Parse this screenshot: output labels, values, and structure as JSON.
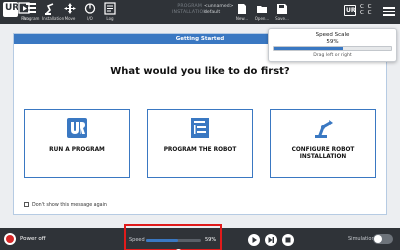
{
  "topbar": {
    "logo_text": "UR",
    "nav": [
      {
        "label": "Run",
        "icon": "run-icon"
      },
      {
        "label": "Program",
        "icon": "program-icon"
      },
      {
        "label": "Installation",
        "icon": "installation-icon"
      },
      {
        "label": "Move",
        "icon": "move-icon"
      },
      {
        "label": "I/O",
        "icon": "io-icon"
      },
      {
        "label": "Log",
        "icon": "log-icon"
      }
    ],
    "program_key": "PROGRAM",
    "program_value": "<unnamed>",
    "installation_key": "INSTALLATION",
    "installation_value": "default",
    "files": [
      {
        "label": "New...",
        "icon": "new-file-icon"
      },
      {
        "label": "Open...",
        "icon": "open-folder-icon"
      },
      {
        "label": "Save...",
        "icon": "save-icon"
      }
    ],
    "badge_text": "UR",
    "cc_top": "C C",
    "cc_bottom": "C C"
  },
  "speed_popup": {
    "title": "Speed Scale",
    "percent_text": "59%",
    "level": 0.59,
    "hint": "Drag left or right"
  },
  "dialog": {
    "header": "Getting Started",
    "question": "What would you like to do first?",
    "choices": [
      {
        "label": "RUN A PROGRAM",
        "icon": "ur-logo-icon"
      },
      {
        "label": "PROGRAM THE ROBOT",
        "icon": "program-list-icon"
      },
      {
        "label": "CONFIGURE ROBOT INSTALLATION",
        "icon": "robot-arm-icon"
      }
    ],
    "dont_show": "Don't show this message again"
  },
  "bottombar": {
    "power_label": "Power off",
    "speed_label": "Speed",
    "speed_value": "59%",
    "speed_level": 0.59,
    "simulation_label": "Simulation",
    "simulation_on": false
  },
  "colors": {
    "accent": "#3a78c2",
    "bar": "#2f3338",
    "highlight": "#e11b1b",
    "power": "#d62828"
  }
}
